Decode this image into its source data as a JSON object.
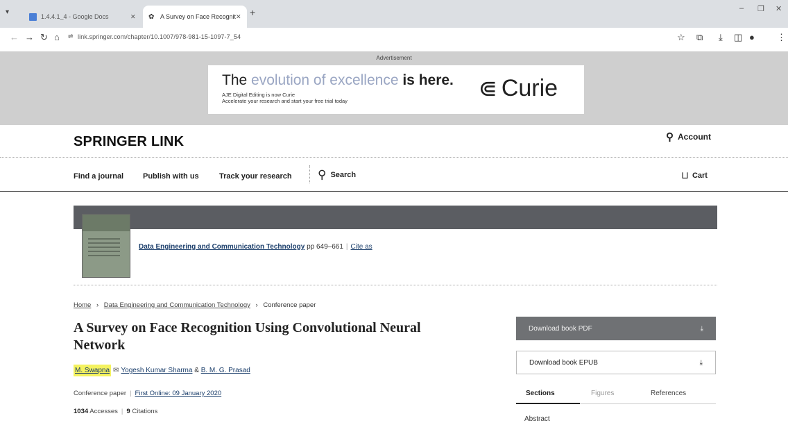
{
  "browser": {
    "tabs": [
      {
        "title": "1.4.4.1_4 - Google Docs",
        "active": false
      },
      {
        "title": "A Survey on Face Recognition",
        "active": true
      }
    ],
    "url": "link.springer.com/chapter/10.1007/978-981-15-1097-7_54"
  },
  "ad": {
    "label": "Advertisement",
    "headline_a": "The ",
    "headline_b": "evolution",
    "headline_c": " of excellence ",
    "headline_d": "is here.",
    "sub_1": "AJE Digital Editing is now Curie",
    "sub_2": "Accelerate your research and start your free trial today",
    "brand": "Curie"
  },
  "header": {
    "logo": "SPRINGER LINK",
    "account": "Account",
    "nav": [
      "Find a journal",
      "Publish with us",
      "Track your research"
    ],
    "search": "Search",
    "cart": "Cart"
  },
  "book": {
    "title": "Data Engineering and Communication Technology",
    "pages": "pp 649–661",
    "cite": "Cite as"
  },
  "breadcrumb": {
    "home": "Home",
    "book": "Data Engineering and Communication Technology",
    "current": "Conference paper"
  },
  "article": {
    "title": "A Survey on Face Recognition Using Convolutional Neural Network",
    "author_1": "M. Swapna",
    "author_2": "Yogesh Kumar Sharma",
    "and": "&",
    "author_3": "B. M. G. Prasad",
    "type": "Conference paper",
    "first_online": "First Online: 09 January 2020",
    "accesses_count": "1034",
    "accesses_label": "Accesses",
    "citations_count": "9",
    "citations_label": "Citations"
  },
  "sidebar": {
    "download_pdf": "Download book PDF",
    "download_epub": "Download book EPUB",
    "tabs": [
      "Sections",
      "Figures",
      "References"
    ],
    "first_section": "Abstract"
  }
}
